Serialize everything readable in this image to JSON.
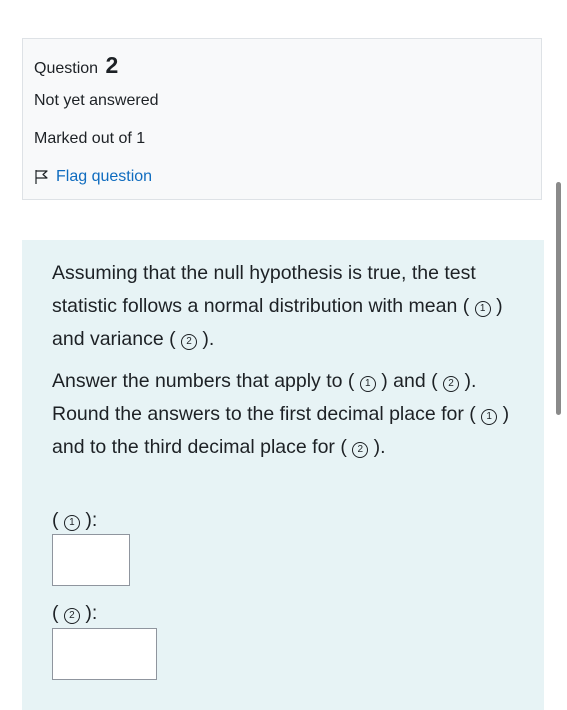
{
  "info": {
    "question_label": "Question",
    "question_number": "2",
    "state": "Not yet answered",
    "grade": "Marked out of 1",
    "flag_label": "Flag question"
  },
  "question": {
    "line1_a": "Assuming that the null hypothesis is true, the test statistic follows a normal distribution with mean ( ",
    "marker1": "1",
    "line1_b": " ) and variance ( ",
    "marker2": "2",
    "line1_c": " ).",
    "line2_a": "Answer the numbers that apply to ( ",
    "line2_b": " ) and ( ",
    "line2_c": " ).",
    "line3_a": "Round the answers to the first decimal place for ( ",
    "line3_b": " ) and to the third decimal place for ( ",
    "line3_c": " )."
  },
  "answers": {
    "label_open": "( ",
    "label_close": " ):",
    "answer1_value": "",
    "answer2_value": ""
  },
  "colors": {
    "link": "#0f6cbf",
    "info_bg": "#f8f9fa",
    "formulation_bg": "#e7f3f5"
  }
}
